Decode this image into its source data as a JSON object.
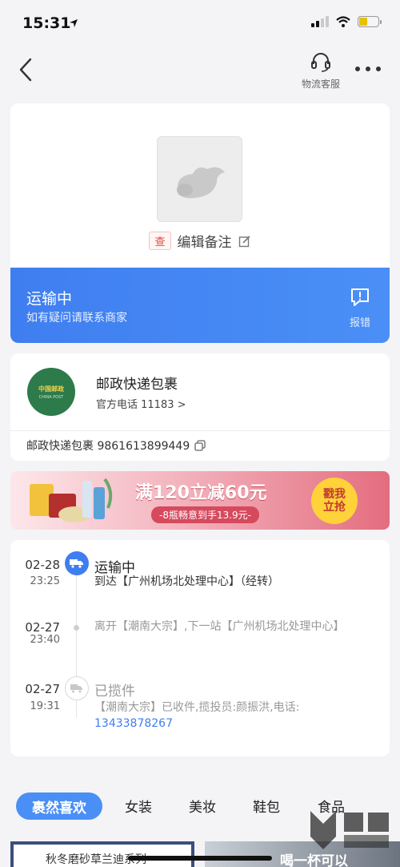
{
  "status_bar": {
    "time": "15:31"
  },
  "nav": {
    "service_label": "物流客服"
  },
  "header": {
    "query_badge": "查",
    "note_label": "编辑备注"
  },
  "status": {
    "title": "运输中",
    "subtitle": "如有疑问请联系商家",
    "report_label": "报错"
  },
  "carrier": {
    "logo_text_cn": "中国邮政",
    "logo_text_en": "CHINA POST",
    "name": "邮政快递包裹",
    "phone": "官方电话 11183 >",
    "tracking": "邮政快递包裹 9861613899449"
  },
  "promo": {
    "title": "满120立减60元",
    "subtitle": "-8瓶畅意到手13.9元-",
    "cta": "戳我立抢"
  },
  "timeline": [
    {
      "date": "02-28",
      "time": "23:25",
      "title": "运输中",
      "text": "到达【广州机场北处理中心】（经转）"
    },
    {
      "date": "02-27",
      "time": "23:40",
      "title": "",
      "text": "离开【潮南大宗】,下一站【广州机场北处理中心】"
    },
    {
      "date": "02-27",
      "time": "19:31",
      "title": "已揽件",
      "text": "【潮南大宗】已收件,揽投员:颜振洪,电话:",
      "phone": "13433878267"
    }
  ],
  "tabs": [
    "裹然喜欢",
    "女装",
    "美妆",
    "鞋包",
    "食品"
  ],
  "recommend": {
    "left_title": "秋冬磨砂草兰迪系列",
    "right_title": "喝一杯可以"
  },
  "colors": {
    "accent": "#3f7ef0",
    "carrier_green": "#2d7a4a",
    "promo_red": "#e46d7f"
  }
}
